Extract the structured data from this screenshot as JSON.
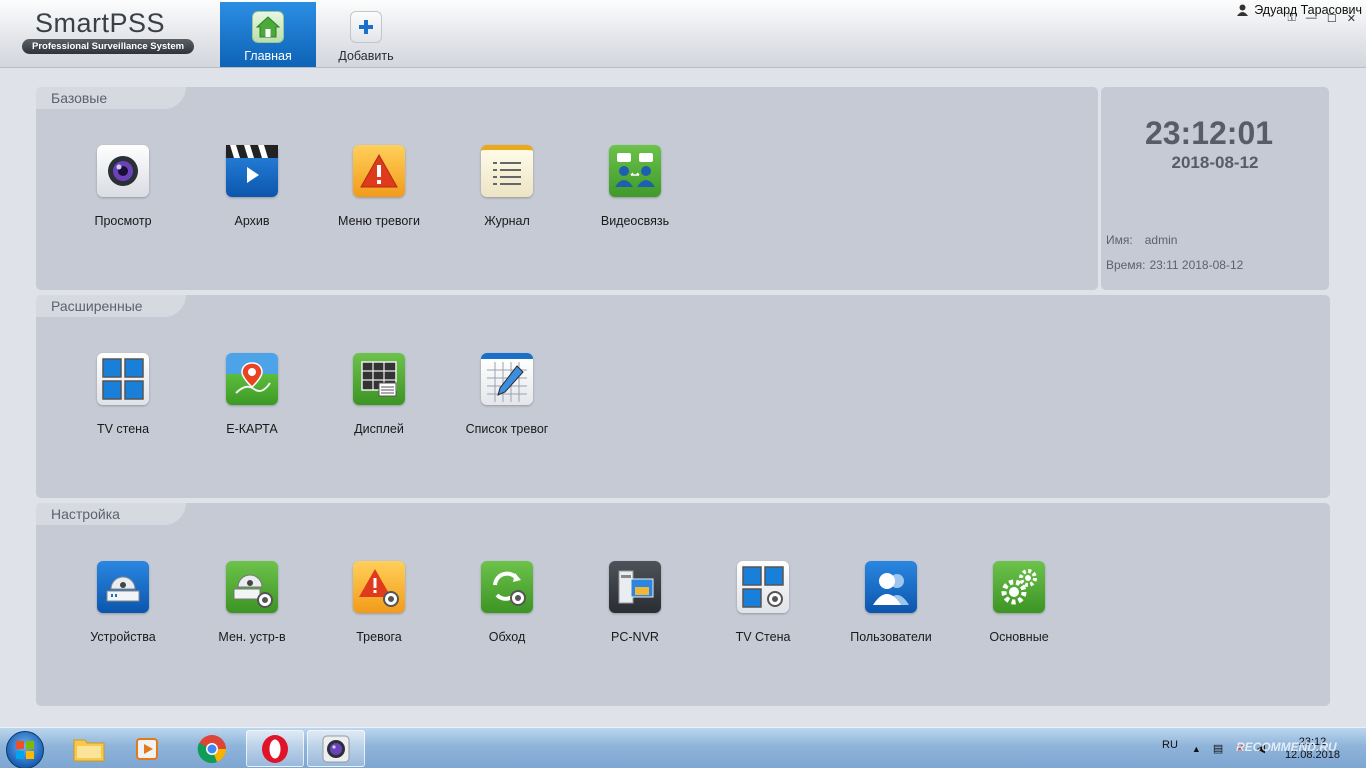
{
  "app": {
    "logo_title": "SmartPSS",
    "logo_subtitle": "Professional Surveillance System",
    "user_name": "Эдуард Тарасович"
  },
  "tabs": [
    {
      "label": "Главная",
      "icon": "home-icon",
      "active": true
    },
    {
      "label": "Добавить",
      "icon": "plus-icon",
      "active": false
    }
  ],
  "sections": {
    "basic": {
      "title": "Базовые",
      "items": [
        {
          "label": "Просмотр",
          "icon": "camera-lens-icon"
        },
        {
          "label": "Архив",
          "icon": "clapperboard-play-icon"
        },
        {
          "label": "Меню тревоги",
          "icon": "alarm-warning-icon"
        },
        {
          "label": "Журнал",
          "icon": "notepad-icon"
        },
        {
          "label": "Видеосвязь",
          "icon": "video-talk-icon"
        }
      ]
    },
    "advanced": {
      "title": "Расширенные",
      "items": [
        {
          "label": "TV стена",
          "icon": "tv-wall-icon"
        },
        {
          "label": "E-КАРТА",
          "icon": "map-pin-icon"
        },
        {
          "label": "Дисплей",
          "icon": "display-grid-icon"
        },
        {
          "label": "Список тревог",
          "icon": "calendar-pencil-icon"
        }
      ]
    },
    "settings": {
      "title": "Настройка",
      "items": [
        {
          "label": "Устройства",
          "icon": "dome-camera-icon"
        },
        {
          "label": "Мен. устр-в",
          "icon": "dome-camera-gear-icon"
        },
        {
          "label": "Тревога",
          "icon": "alarm-gear-icon"
        },
        {
          "label": "Обход",
          "icon": "tour-refresh-icon"
        },
        {
          "label": "PC-NVR",
          "icon": "pc-nvr-icon"
        },
        {
          "label": "TV Стена",
          "icon": "tv-wall-gear-icon"
        },
        {
          "label": "Пользователи",
          "icon": "users-icon"
        },
        {
          "label": "Основные",
          "icon": "gears-icon"
        }
      ]
    }
  },
  "clock": {
    "time": "23:12:01",
    "date": "2018-08-12",
    "name_label": "Имя:",
    "name_value": "admin",
    "time_label": "Время:",
    "time_value": "23:11 2018-08-12"
  },
  "taskbar": {
    "lang": "RU",
    "time": "23:12",
    "date": "12.08.2018",
    "watermark": "RECOMMEND.RU",
    "pinned": [
      "explorer-icon",
      "media-player-icon",
      "chrome-icon",
      "opera-icon",
      "smartpss-icon"
    ]
  },
  "colors": {
    "accent": "#1a7ad4",
    "panel": "#c5cad4",
    "panel_tab": "#d6d9df",
    "background": "#dfe2e8"
  }
}
